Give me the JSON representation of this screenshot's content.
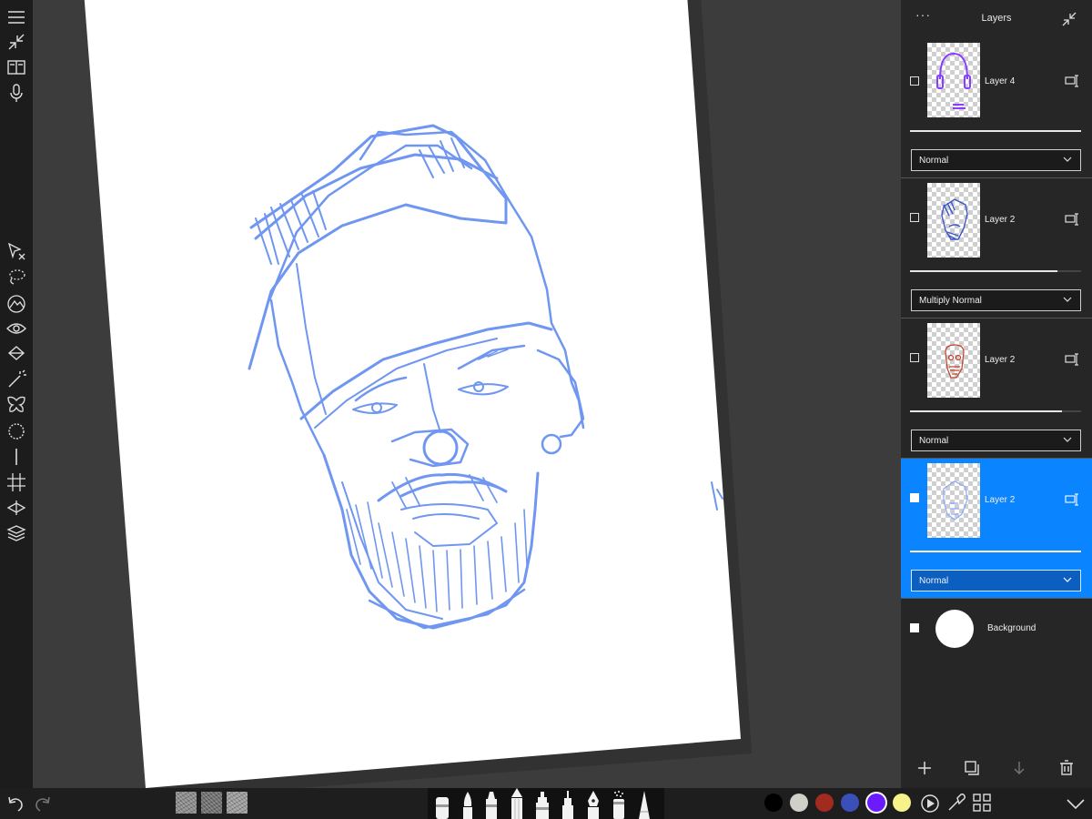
{
  "layers_panel": {
    "title": "Layers",
    "more": "···",
    "layers": [
      {
        "name": "Layer 4",
        "blend": "Normal",
        "opacity": 1.0,
        "selected": false,
        "thumb_color": "#8a3cff"
      },
      {
        "name": "Layer 2",
        "blend": "Multiply Normal",
        "opacity": 0.86,
        "selected": false,
        "thumb_color": "#3a56c8"
      },
      {
        "name": "Layer 2",
        "blend": "Normal",
        "opacity": 0.89,
        "selected": false,
        "thumb_color": "#c0412a"
      },
      {
        "name": "Layer 2",
        "blend": "Normal",
        "opacity": 1.0,
        "selected": true,
        "thumb_color": "#8aa8ff"
      }
    ],
    "background": {
      "name": "Background"
    }
  },
  "palette": {
    "colors": [
      "#000000",
      "#d0d0c8",
      "#a32a1e",
      "#3b4fb8",
      "#6a1cff",
      "#f7f28a"
    ],
    "active_index": 4
  },
  "sketch_color": "#6f96f0",
  "icons": {
    "left_tools": [
      "menu-icon",
      "collapse-icon",
      "book-icon",
      "microphone-icon",
      "transform-icon",
      "lasso-icon",
      "adjust-icon",
      "eye-icon",
      "fill-icon",
      "magic-wand-icon",
      "symmetry-icon",
      "circle-icon",
      "line-icon",
      "grid-icon",
      "perspective-icon",
      "layers-icon"
    ],
    "brushes": [
      "marker-brush-icon",
      "round-brush-icon",
      "felt-pen-icon",
      "pencil-icon",
      "highlighter-icon",
      "ink-pen-icon",
      "fountain-pen-icon",
      "spray-icon",
      "stylus-icon"
    ]
  }
}
